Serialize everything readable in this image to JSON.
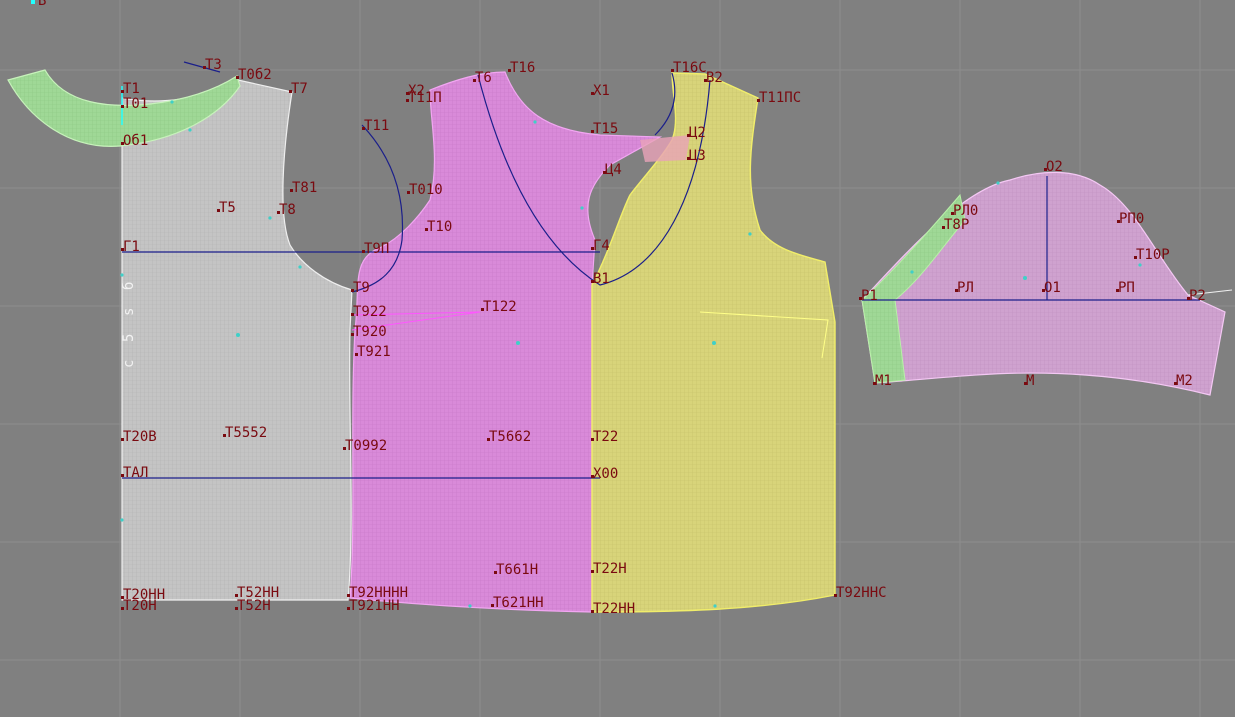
{
  "canvas": {
    "corner_label": "В",
    "colors": {
      "background": "#808080",
      "grid": "#8e8e8e",
      "label": "#7a0a10",
      "construction_line": "#1b1f8a",
      "back_fill": "#c4c4c4",
      "front_fill": "#d784d7",
      "front_overlay_fill": "#d8d47a",
      "collar_fill": "#a8e0a0",
      "sleeve_fill": "#cfa0cf",
      "green_edge": "#9de08a",
      "yellow_edge": "#f1ee6a"
    },
    "back_side_vertical_text": [
      "б",
      "s",
      "5",
      "с"
    ],
    "pieces": {
      "back": [
        {
          "id": "T1",
          "text": "Т1"
        },
        {
          "id": "T01",
          "text": "Т01"
        },
        {
          "id": "Ob1",
          "text": "Об1"
        },
        {
          "id": "T3",
          "text": "Т3"
        },
        {
          "id": "T062",
          "text": "Т0б2"
        },
        {
          "id": "T7",
          "text": "Т7"
        },
        {
          "id": "T81",
          "text": "Т81"
        },
        {
          "id": "T5",
          "text": "Т5"
        },
        {
          "id": "T8",
          "text": "Т8"
        },
        {
          "id": "G1",
          "text": "Г1"
        },
        {
          "id": "T9",
          "text": "Т9"
        },
        {
          "id": "T20B",
          "text": "Т20В"
        },
        {
          "id": "T552",
          "text": "Т5552"
        },
        {
          "id": "TAL",
          "text": "ТАЛ"
        },
        {
          "id": "T20NN",
          "text": "Т20НН"
        },
        {
          "id": "T20N",
          "text": "Т20Н"
        },
        {
          "id": "T52NN",
          "text": "Т52НН"
        },
        {
          "id": "T52N",
          "text": "Т52Н"
        }
      ],
      "front": [
        {
          "id": "X2",
          "text": "Х2"
        },
        {
          "id": "T11P",
          "text": "Т11П"
        },
        {
          "id": "T6",
          "text": "Т6"
        },
        {
          "id": "T16",
          "text": "Т16"
        },
        {
          "id": "X1",
          "text": "Х1"
        },
        {
          "id": "T11",
          "text": "Т11"
        },
        {
          "id": "T15",
          "text": "Т15"
        },
        {
          "id": "T010",
          "text": "Т010"
        },
        {
          "id": "T10",
          "text": "Т10"
        },
        {
          "id": "T9P",
          "text": "Т9П"
        },
        {
          "id": "G4",
          "text": "Г4"
        },
        {
          "id": "B1",
          "text": "В1"
        },
        {
          "id": "T922",
          "text": "Т922"
        },
        {
          "id": "T920",
          "text": "Т920"
        },
        {
          "id": "T921",
          "text": "Т921"
        },
        {
          "id": "T122",
          "text": "Т122"
        },
        {
          "id": "T992",
          "text": "Т0992"
        },
        {
          "id": "T662",
          "text": "Т5662"
        },
        {
          "id": "T22",
          "text": "Т22"
        },
        {
          "id": "X00",
          "text": "Х00"
        },
        {
          "id": "T61N",
          "text": "Т661Н"
        },
        {
          "id": "T22N",
          "text": "Т22Н"
        },
        {
          "id": "T92NNN",
          "text": "Т92НННН"
        },
        {
          "id": "T921N",
          "text": "Т921НН"
        },
        {
          "id": "T621NN",
          "text": "Т621НН"
        },
        {
          "id": "T22NN",
          "text": "Т22НН"
        }
      ],
      "front_overlay": [
        {
          "id": "T16S",
          "text": "Т16С"
        },
        {
          "id": "V2",
          "text": "В2"
        },
        {
          "id": "T11PS",
          "text": "Т11ПС"
        },
        {
          "id": "Ts2",
          "text": "Ц2"
        },
        {
          "id": "Ts3",
          "text": "Ц3"
        },
        {
          "id": "Ts4",
          "text": "Ц4"
        },
        {
          "id": "T92NNS",
          "text": "Т92ННС"
        }
      ],
      "sleeve": [
        {
          "id": "O2",
          "text": "О2"
        },
        {
          "id": "RL0",
          "text": "РЛ0"
        },
        {
          "id": "T8R",
          "text": "Т8Р"
        },
        {
          "id": "RP0",
          "text": "РП0"
        },
        {
          "id": "T10R",
          "text": "Т10Р"
        },
        {
          "id": "R1",
          "text": "Р1"
        },
        {
          "id": "RL",
          "text": "РЛ"
        },
        {
          "id": "O1",
          "text": "О1"
        },
        {
          "id": "RP",
          "text": "РП"
        },
        {
          "id": "R2",
          "text": "Р2"
        },
        {
          "id": "M1",
          "text": "М1"
        },
        {
          "id": "M",
          "text": "М"
        },
        {
          "id": "M2",
          "text": "М2"
        }
      ]
    }
  }
}
